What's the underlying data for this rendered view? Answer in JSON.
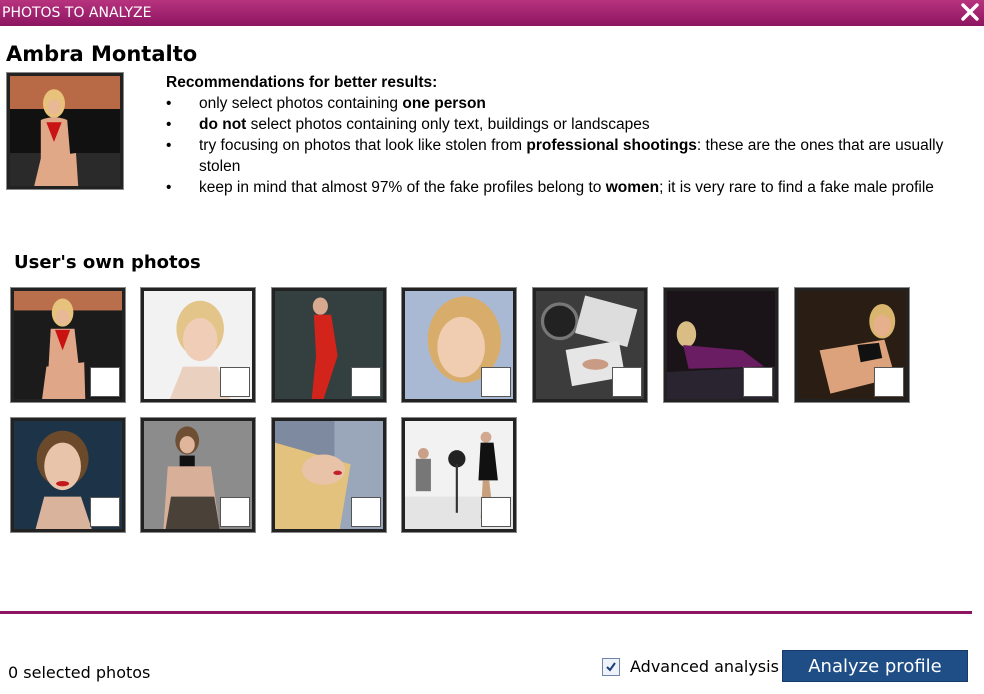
{
  "window": {
    "title": "PHOTOS TO ANALYZE"
  },
  "profile": {
    "name": "Ambra Montalto"
  },
  "recommendations": {
    "title": "Recommendations for better results:",
    "items": [
      {
        "pre": "only select photos containing ",
        "bold": "one person",
        "post": ""
      },
      {
        "pre": "",
        "bold": "do not",
        "post": " select photos containing only text, buildings or landscapes"
      },
      {
        "pre": "try focusing on photos that look like stolen from ",
        "bold": "professional shootings",
        "post": ": these are the ones that are usually stolen"
      },
      {
        "pre": "keep in mind that almost 97% of the fake profiles belong to ",
        "bold": "women",
        "post": "; it is very rare to find a fake male profile"
      }
    ]
  },
  "photos_section": {
    "title": "User's own photos"
  },
  "footer": {
    "selected_text": "0 selected photos",
    "advanced_label": "Advanced analysis",
    "advanced_checked": true,
    "analyze_button": "Analyze profile"
  },
  "colors": {
    "titlebar": "#a02470",
    "button": "#1f4e86",
    "divider": "#8d1561"
  }
}
